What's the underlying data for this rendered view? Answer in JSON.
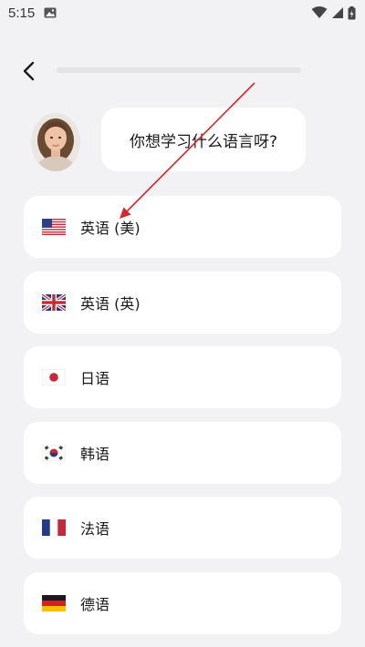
{
  "status_bar": {
    "time": "5:15"
  },
  "header": {
    "back_icon": "chevron-left-icon",
    "progress": 0.0
  },
  "prompt": {
    "question": "你想学习什么语言呀?"
  },
  "options": [
    {
      "label": "英语 (美)",
      "flag": "us-flag-icon"
    },
    {
      "label": "英语 (英)",
      "flag": "uk-flag-icon"
    },
    {
      "label": "日语",
      "flag": "japan-flag-icon"
    },
    {
      "label": "韩语",
      "flag": "korea-flag-icon"
    },
    {
      "label": "法语",
      "flag": "france-flag-icon"
    },
    {
      "label": "德语",
      "flag": "germany-flag-icon"
    }
  ],
  "colors": {
    "background": "#f2f2f4",
    "card": "#ffffff",
    "annotation_arrow": "#d9262c"
  }
}
